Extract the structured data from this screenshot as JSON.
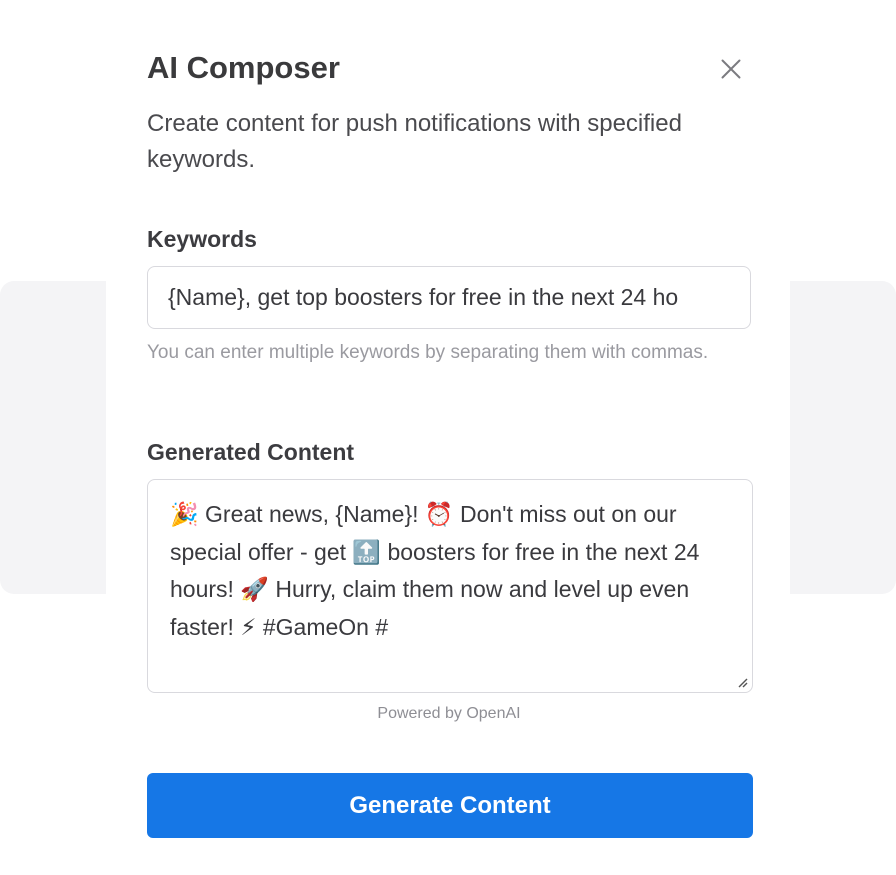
{
  "modal": {
    "title": "AI Composer",
    "subtitle": "Create content for push notifications with specified keywords.",
    "close_icon": "close-icon"
  },
  "keywords": {
    "label": "Keywords",
    "value": "{Name}, get top boosters for free in the next 24 ho",
    "hint": "You can enter multiple keywords by separating them with commas."
  },
  "generated": {
    "label": "Generated Content",
    "segments": {
      "s1": "Great news, {Name}!",
      "s2": "Don't miss out on our special offer - get",
      "s3": "boosters for free in the next 24 hours!",
      "s4": "Hurry, claim them now and level up even faster!",
      "s5": "#GameOn #"
    },
    "emojis": {
      "party": "🎉",
      "alarm": "⏰",
      "top": "🔝",
      "rocket": "🚀",
      "lightning": "⚡"
    },
    "powered_by": "Powered by OpenAI"
  },
  "actions": {
    "generate_label": "Generate Content"
  },
  "colors": {
    "primary": "#1677e6",
    "border": "#d9d9de",
    "backdrop": "#f4f4f6"
  }
}
